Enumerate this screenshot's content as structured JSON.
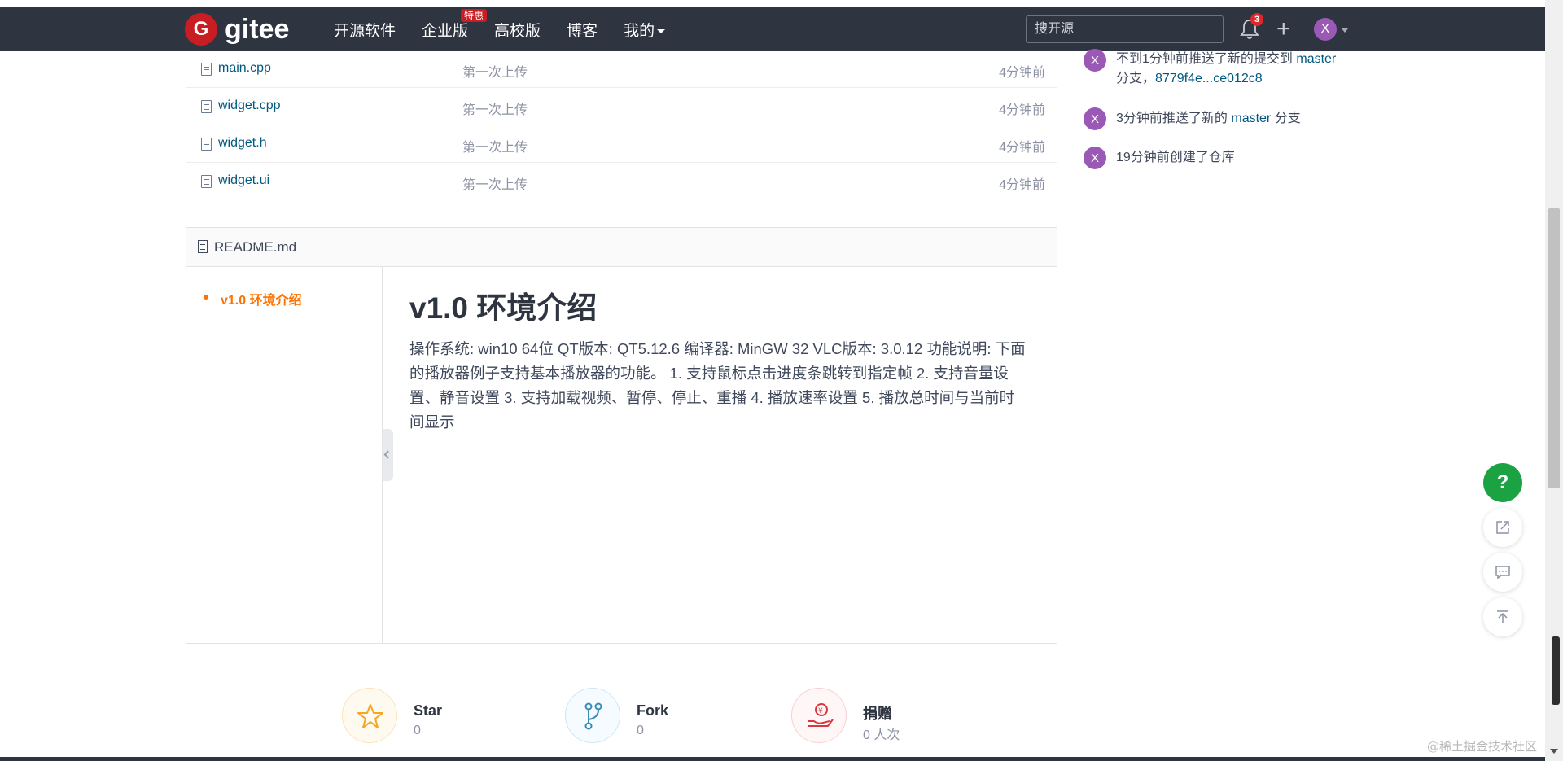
{
  "navbar": {
    "logo_mark": "G",
    "logo_text": "gitee",
    "links": [
      "开源软件",
      "企业版",
      "高校版",
      "博客",
      "我的"
    ],
    "enterprise_badge": "特惠",
    "search_placeholder": "搜开源",
    "notification_count": "3",
    "plus": "+",
    "avatar_letter": "X"
  },
  "files": [
    {
      "name": "main.cpp",
      "message": "第一次上传",
      "time": "4分钟前"
    },
    {
      "name": "widget.cpp",
      "message": "第一次上传",
      "time": "4分钟前"
    },
    {
      "name": "widget.h",
      "message": "第一次上传",
      "time": "4分钟前"
    },
    {
      "name": "widget.ui",
      "message": "第一次上传",
      "time": "4分钟前"
    }
  ],
  "readme": {
    "title": "README.md",
    "toc_item": "v1.0 环境介绍",
    "heading": "v1.0 环境介绍",
    "paragraph": "操作系统: win10 64位 QT版本:  QT5.12.6 编译器:  MinGW 32 VLC版本: 3.0.12 功能说明:  下面的播放器例子支持基本播放器的功能。 1. 支持鼠标点击进度条跳转到指定帧   2. 支持音量设置、静音设置 3. 支持加载视频、暂停、停止、重播 4. 播放速率设置 5. 播放总时间与当前时间显示"
  },
  "activity": [
    {
      "avatar": "X",
      "prefix": "不到1分钟前推送了新的提交到 ",
      "link": "master",
      "line2_prefix": "分支，",
      "line2_link": "8779f4e...ce012c8"
    },
    {
      "avatar": "X",
      "prefix": "3分钟前推送了新的 ",
      "link": "master",
      "suffix": " 分支"
    },
    {
      "avatar": "X",
      "text": "19分钟前创建了仓库"
    }
  ],
  "stats": {
    "star": {
      "label": "Star",
      "count": "0"
    },
    "fork": {
      "label": "Fork",
      "count": "0"
    },
    "donate": {
      "label": "捐赠",
      "count": "0 人次"
    }
  },
  "float_buttons": {
    "help": "?"
  },
  "watermark": "@稀土掘金技术社区",
  "colors": {
    "navbar": "#2e3440",
    "accent": "#fe7300",
    "link": "#005980",
    "brand": "#c71d23",
    "help": "#1ba243",
    "avatar": "#9b59b6"
  }
}
